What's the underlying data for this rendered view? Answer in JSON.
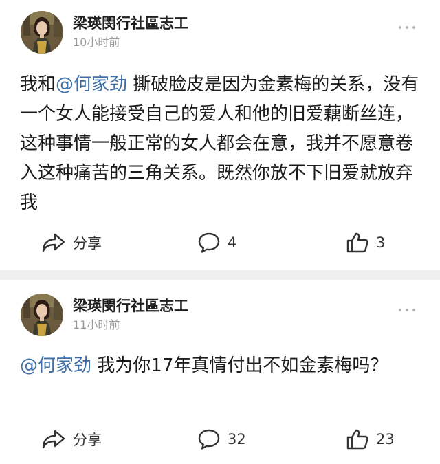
{
  "posts": [
    {
      "author": "梁瑛閔行社區志工",
      "time": "10小时前",
      "mention": "@何家劲",
      "text": " 撕破脸皮是因为金素梅的关系，没有一个女人能接受自己的爱人和他的旧爱藕断丝连，这种事情一般正常的女人都会在意，我并不愿意卷入这种痛苦的三角关系。既然你放不下旧爱就放弃我",
      "actions": {
        "share_label": "分享",
        "comment_count": "4",
        "like_count": "3"
      }
    },
    {
      "author": "梁瑛閔行社區志工",
      "time": "11小时前",
      "mention": "@何家劲",
      "text": " 我为你17年真情付出不如金素梅吗？",
      "actions": {
        "share_label": "分享",
        "comment_count": "32",
        "like_count": "23"
      }
    }
  ],
  "icons": {
    "share": "share-arrow-icon",
    "comment": "speech-bubble-icon",
    "like": "thumbs-up-icon",
    "more": "more-dots-icon"
  },
  "colors": {
    "mention": "#3f6fa8",
    "timestamp": "#9a9a9a",
    "separator": "#f1f1f1"
  }
}
